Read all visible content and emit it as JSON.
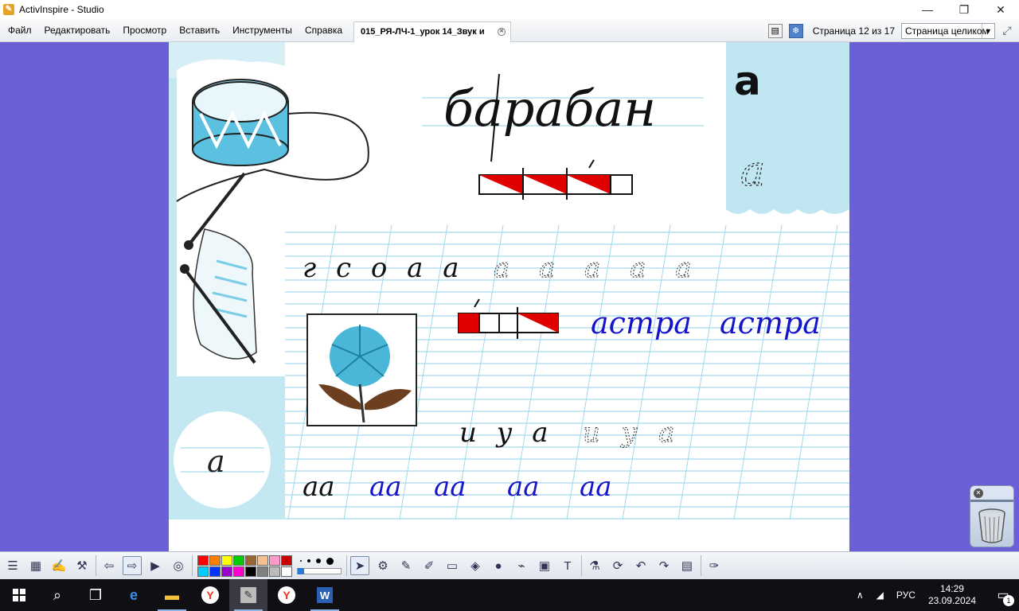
{
  "window": {
    "title": "ActivInspire - Studio",
    "minimize_glyph": "—",
    "maximize_glyph": "❐",
    "close_glyph": "✕"
  },
  "menu": {
    "items": [
      "Файл",
      "Редактировать",
      "Просмотр",
      "Вставить",
      "Инструменты",
      "Справка"
    ],
    "doc_tab": "015_РЯ-ЛЧ-1_урок 14_Звук и",
    "page_indicator": "Страница 12 из 17",
    "zoom": "Страница целиком"
  },
  "flipchart": {
    "word_top": "барабан",
    "letter_print": "а",
    "row_letters": "г с о а а",
    "row_letters_trace": "а а а а а",
    "word_astra_1": "астра",
    "word_astra_2": "астра",
    "row_bottom": "и у а",
    "row_bottom_trace": "и у а",
    "aa_black": "аа",
    "aa_blue": [
      "аа",
      "аа",
      "аа",
      "аа"
    ]
  },
  "toolbar": {
    "colors": [
      "#ff0000",
      "#ff8000",
      "#ffff00",
      "#00cc00",
      "#996633",
      "#f5c090",
      "#ff99cc",
      "#cc0000",
      "#00ccff",
      "#0033ff",
      "#9900cc",
      "#ff00cc",
      "#000000",
      "#808080",
      "#bbbbbb",
      "#ffffff"
    ]
  },
  "taskbar": {
    "language": "РУС",
    "time": "14:29",
    "date": "23.09.2024",
    "notifications": "1"
  }
}
